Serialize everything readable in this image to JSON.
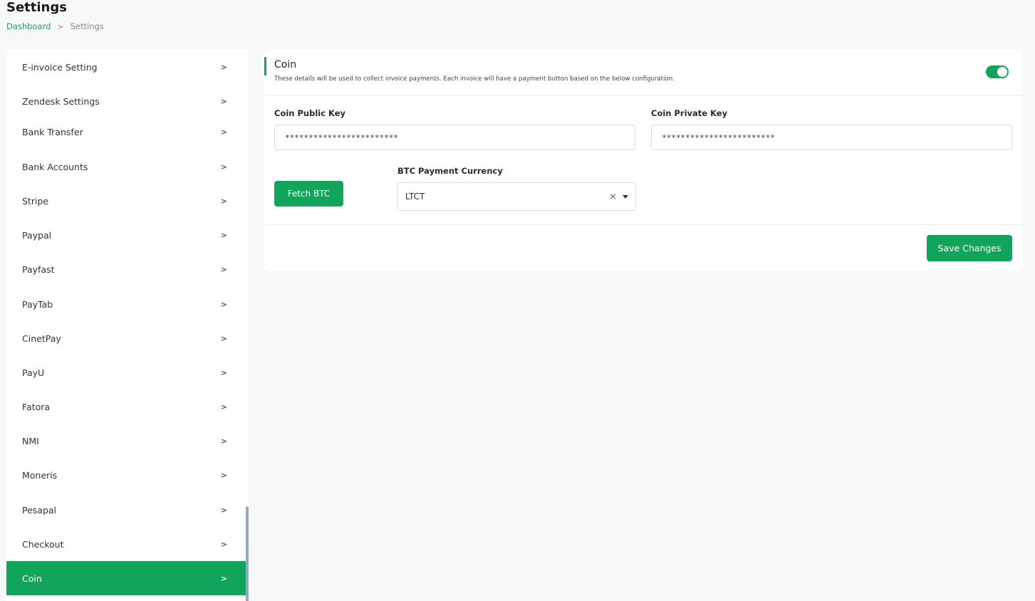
{
  "header": {
    "title": "Settings",
    "breadcrumb": {
      "home": "Dashboard",
      "separator": ">",
      "current": "Settings"
    }
  },
  "sidebar": {
    "items": [
      {
        "label": "E-invoice Setting",
        "active": false
      },
      {
        "label": "Zendesk Settings",
        "active": false
      },
      {
        "label": "Bank Transfer",
        "active": false
      },
      {
        "label": "Bank Accounts",
        "active": false
      },
      {
        "label": "Stripe",
        "active": false
      },
      {
        "label": "Paypal",
        "active": false
      },
      {
        "label": "Payfast",
        "active": false
      },
      {
        "label": "PayTab",
        "active": false
      },
      {
        "label": "CinetPay",
        "active": false
      },
      {
        "label": "PayU",
        "active": false
      },
      {
        "label": "Fatora",
        "active": false
      },
      {
        "label": "NMI",
        "active": false
      },
      {
        "label": "Moneris",
        "active": false
      },
      {
        "label": "Pesapal",
        "active": false
      },
      {
        "label": "Checkout",
        "active": false
      },
      {
        "label": "Coin",
        "active": true
      }
    ],
    "chevron": ">"
  },
  "card": {
    "title": "Coin",
    "description": "These details will be used to collect invoice payments. Each invoice will have a payment button based on the below configuration.",
    "enabled": true,
    "public_key_label": "Coin Public Key",
    "public_key_value": "************************",
    "private_key_label": "Coin Private Key",
    "private_key_value": "************************",
    "fetch_button": "Fetch BTC",
    "currency_label": "BTC Payment Currency",
    "currency_value": "LTCT",
    "clear_symbol": "×",
    "save_button": "Save Changes"
  },
  "colors": {
    "accent": "#10a55b",
    "background": "#f7f8f9"
  }
}
